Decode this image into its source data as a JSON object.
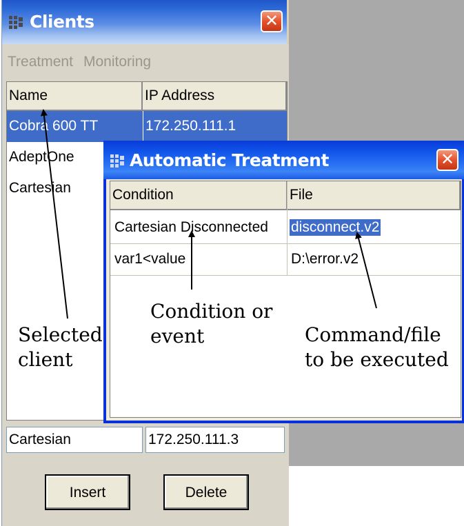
{
  "clients_window": {
    "title": "Clients",
    "menu": [
      "Treatment",
      "Monitoring"
    ],
    "columns": [
      "Name",
      "IP Address"
    ],
    "rows": [
      {
        "name": "Cobra 600 TT",
        "ip": "172.250.111.1",
        "selected": true
      },
      {
        "name": "AdeptOne",
        "ip": "",
        "selected": false
      },
      {
        "name": "Cartesian",
        "ip": "",
        "selected": false
      }
    ],
    "name_input": "Cartesian",
    "ip_input": "172.250.111.3",
    "insert_label": "Insert",
    "delete_label": "Delete"
  },
  "treatment_dialog": {
    "title": "Automatic Treatment",
    "columns": [
      "Condition",
      "File"
    ],
    "rows": [
      {
        "condition": "Cartesian Disconnected",
        "file": "disconnect.v2",
        "file_selected": true
      },
      {
        "condition": "var1<value",
        "file": "D:\\error.v2",
        "file_selected": false
      }
    ]
  },
  "annotations": {
    "selected_client": [
      "Selected",
      "client"
    ],
    "condition_event": [
      "Condition  or",
      "event"
    ],
    "command_file": [
      "Command/file",
      "to be executed"
    ]
  },
  "icons": {
    "window_icon": "app-grid-icon",
    "close": "close-x-icon"
  },
  "colors": {
    "selection": "#3e6cc8",
    "title_blue": "#0f52e8",
    "close_red": "#e5522d",
    "window_face": "#d9d5c9"
  }
}
